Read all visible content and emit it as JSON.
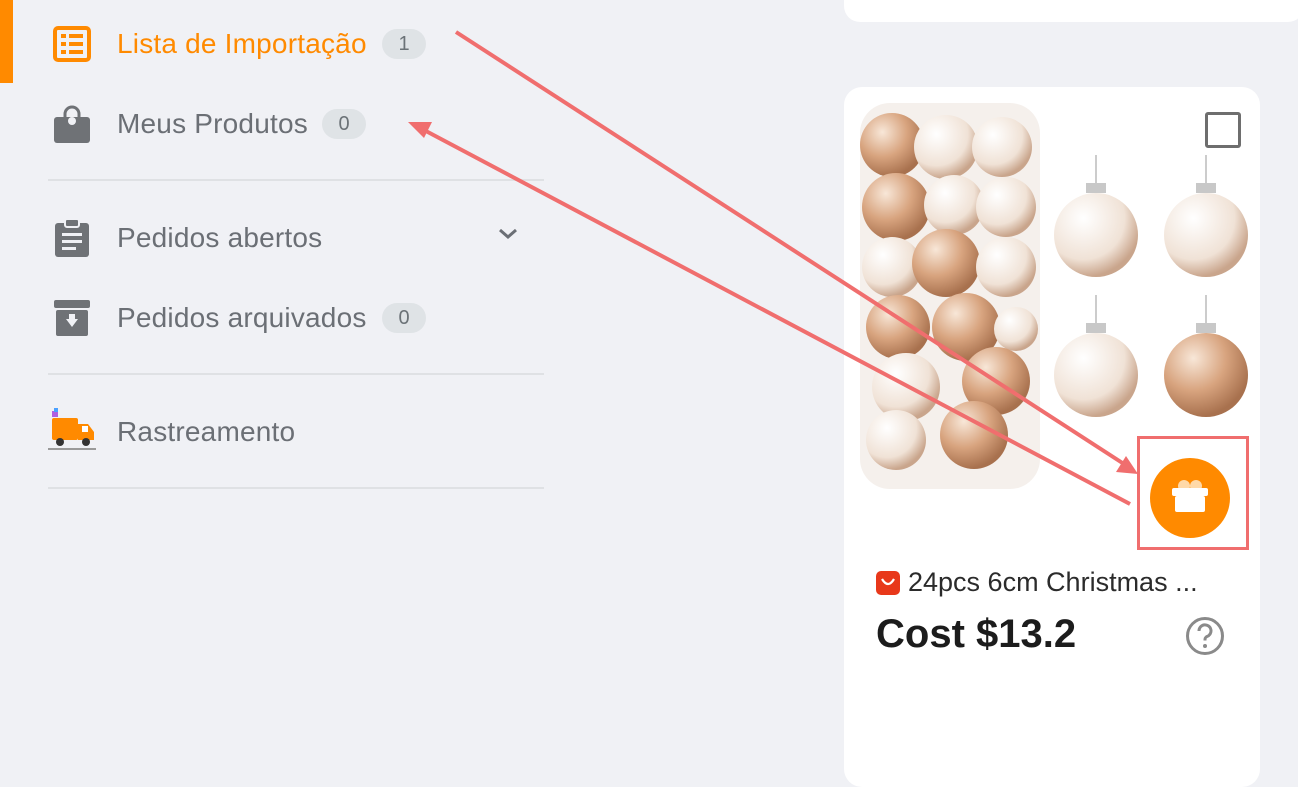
{
  "sidebar": {
    "items": [
      {
        "label": "Lista de Importação",
        "badge": "1",
        "icon": "list-icon",
        "active": true
      },
      {
        "label": "Meus Produtos",
        "badge": "0",
        "icon": "shopping-bag-icon"
      },
      {
        "label": "Pedidos abertos",
        "icon": "clipboard-icon",
        "chevron": "chevron-down-icon"
      },
      {
        "label": "Pedidos arquivados",
        "badge": "0",
        "icon": "archive-icon"
      },
      {
        "label": "Rastreamento",
        "icon": "delivery-truck-icon"
      }
    ]
  },
  "product": {
    "title": "24pcs 6cm Christmas ...",
    "cost": "Cost $13.2",
    "source_icon": "aliexpress-icon",
    "help_icon": "question-circle-icon",
    "import_icon": "import-gift-icon"
  },
  "colors": {
    "accent": "#ff8a00",
    "annotation": "#f06e6e",
    "background": "#f0f1f5",
    "text_muted": "#6b6f75"
  }
}
